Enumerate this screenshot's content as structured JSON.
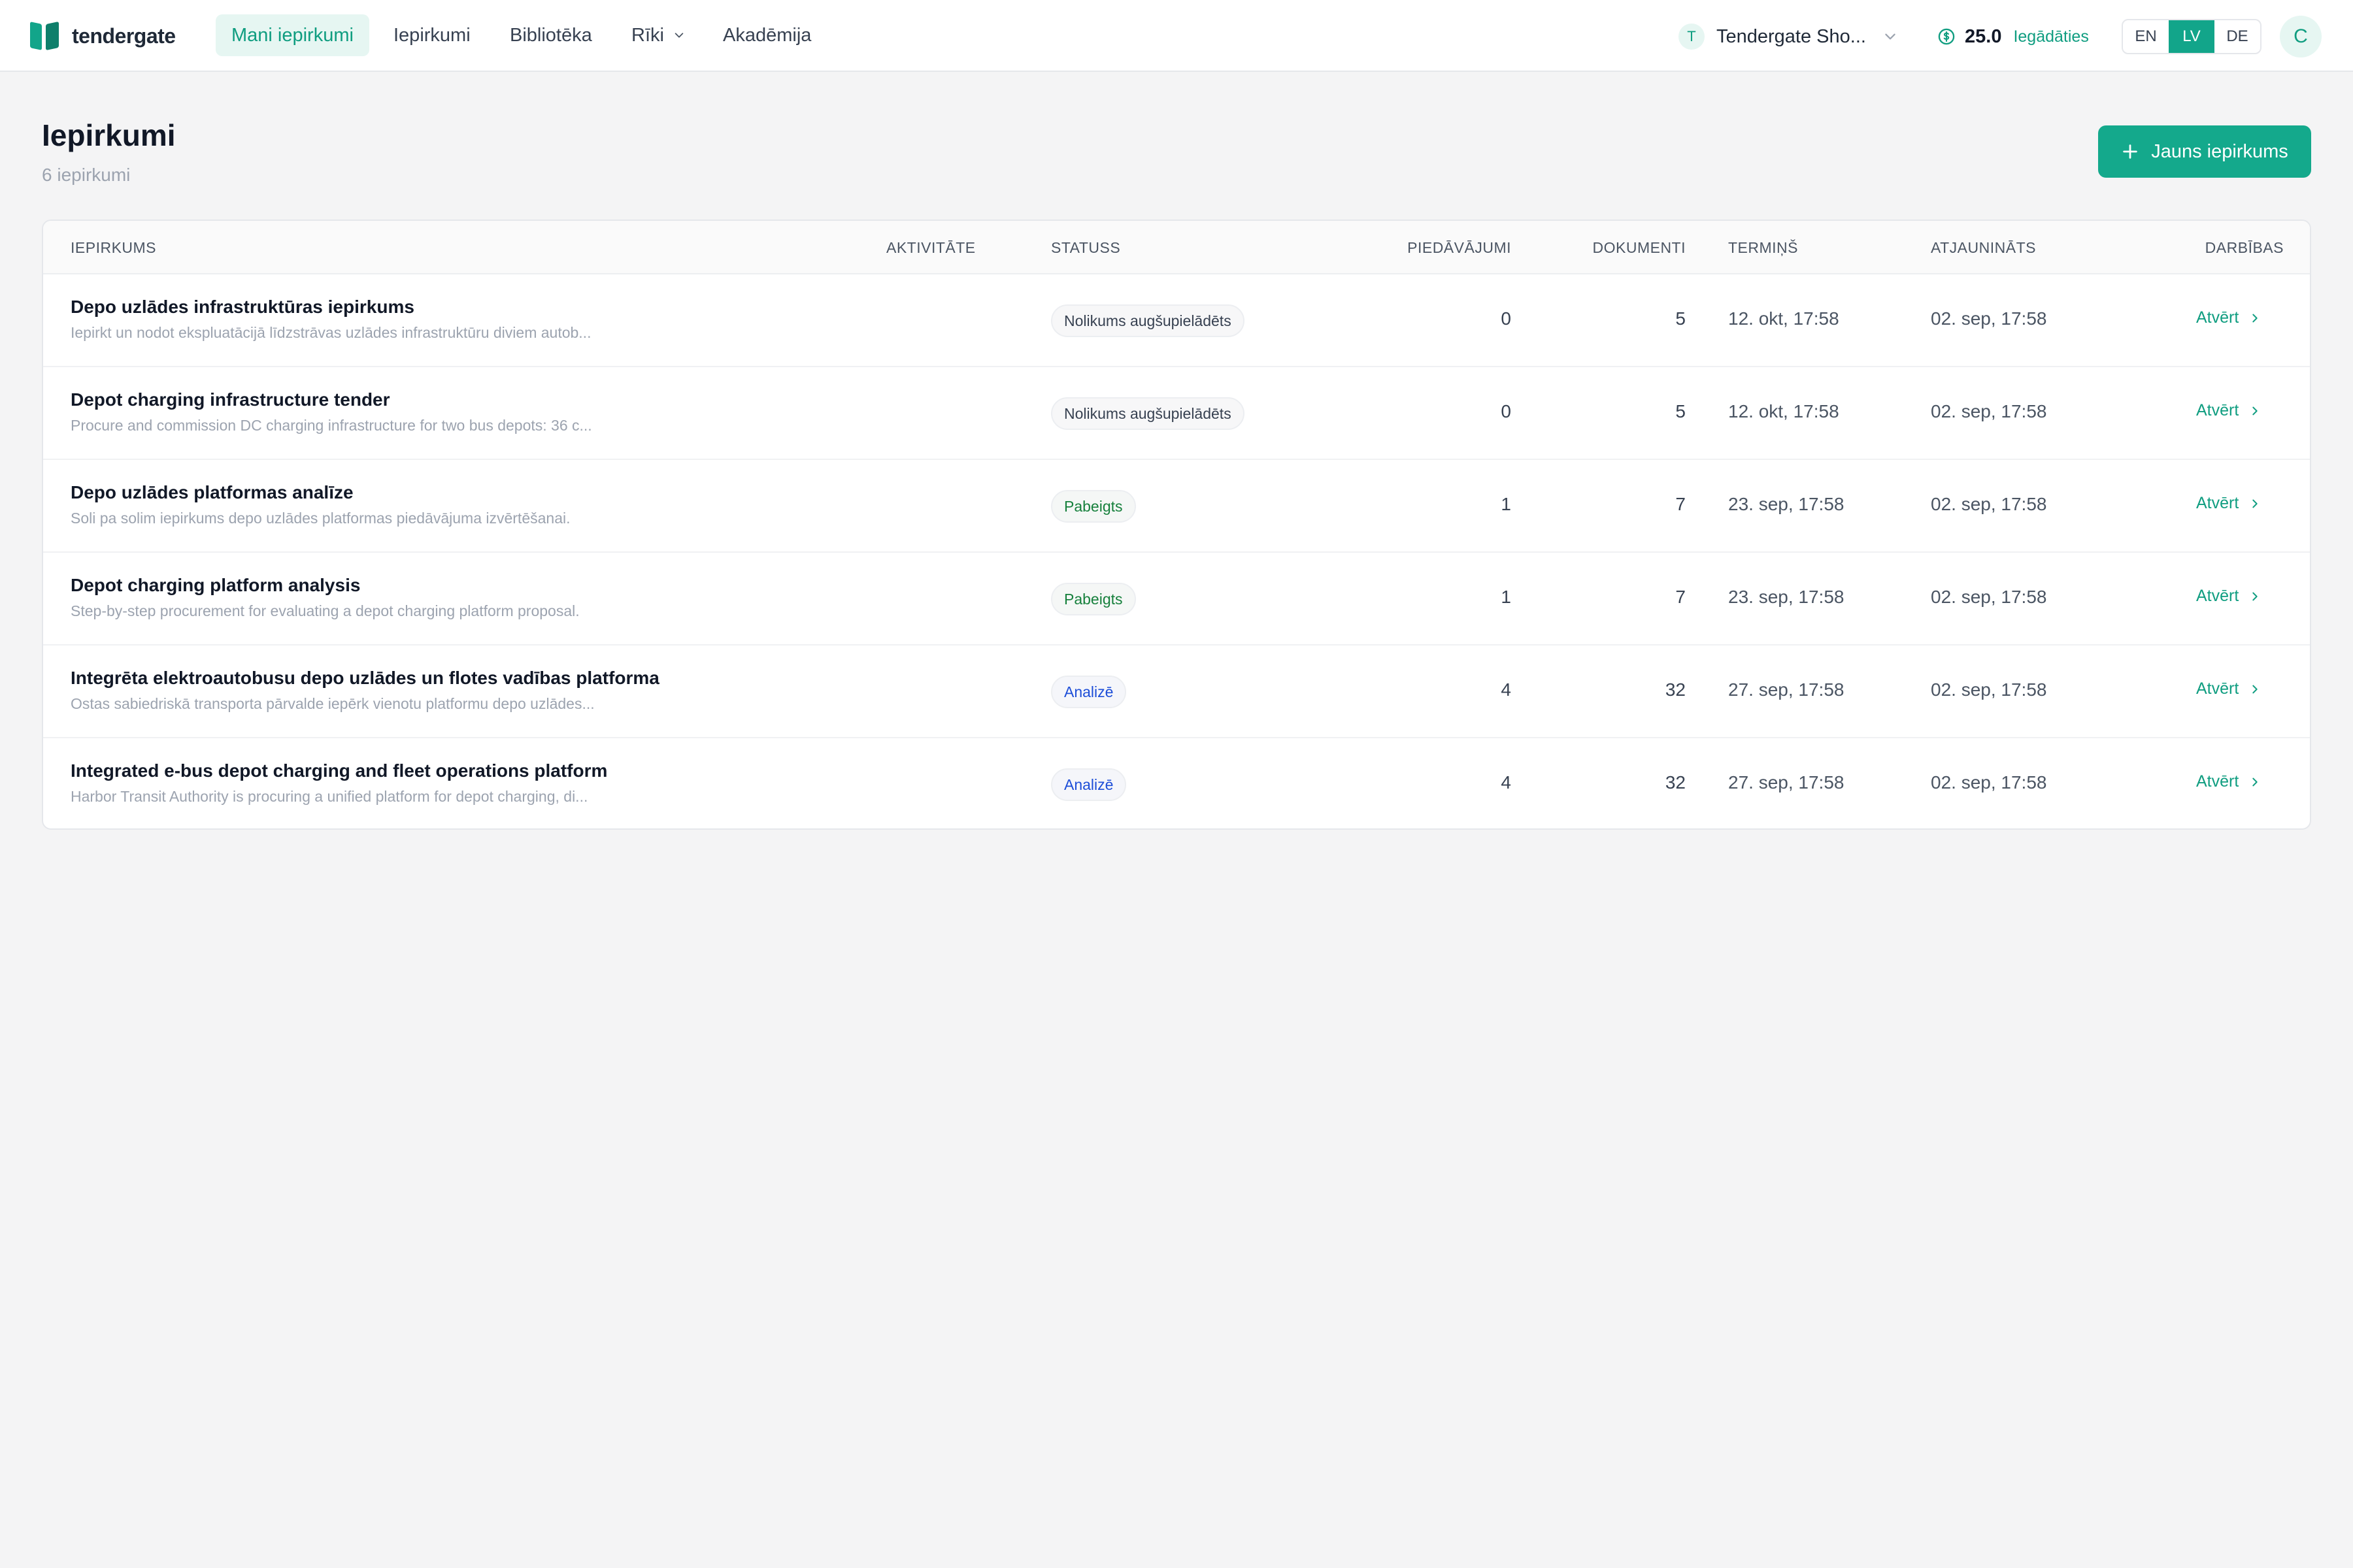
{
  "brand": {
    "name": "tendergate"
  },
  "nav": {
    "items": [
      {
        "label": "Mani iepirkumi",
        "active": true
      },
      {
        "label": "Iepirkumi",
        "active": false
      },
      {
        "label": "Bibliotēka",
        "active": false
      },
      {
        "label": "Rīki",
        "active": false,
        "has_dropdown": true
      },
      {
        "label": "Akadēmija",
        "active": false
      }
    ]
  },
  "team": {
    "initial": "T",
    "name": "Tendergate Sho..."
  },
  "credits": {
    "value": "25.0",
    "topup_label": "Iegādāties",
    "icon": "coin-icon"
  },
  "languages": {
    "options": [
      "EN",
      "LV",
      "DE"
    ],
    "selected": "LV"
  },
  "user": {
    "initial": "C"
  },
  "page": {
    "title": "Iepirkumi",
    "subtitle": "6 iepirkumi",
    "new_button_label": "Jauns iepirkums"
  },
  "table": {
    "headers": {
      "procurement": "IEPIRKUMS",
      "activity": "AKTIVITĀTE",
      "status": "STATUSS",
      "offers": "PIEDĀVĀJUMI",
      "documents": "DOKUMENTI",
      "deadline": "TERMIŅŠ",
      "updated": "ATJAUNINĀTS",
      "actions": "DARBĪBAS"
    },
    "rows": [
      {
        "title": "Depo uzlādes infrastruktūras iepirkums",
        "description": "Iepirkt un nodot ekspluatācijā līdzstrāvas uzlādes infrastruktūru diviem autob...",
        "status": "Nolikums augšupielādēts",
        "status_kind": "neutral",
        "offers": "0",
        "documents": "5",
        "deadline": "12. okt, 17:58",
        "updated": "02. sep, 17:58",
        "action": "Atvērt"
      },
      {
        "title": "Depot charging infrastructure tender",
        "description": "Procure and commission DC charging infrastructure for two bus depots: 36 c...",
        "status": "Nolikums augšupielādēts",
        "status_kind": "neutral",
        "offers": "0",
        "documents": "5",
        "deadline": "12. okt, 17:58",
        "updated": "02. sep, 17:58",
        "action": "Atvērt"
      },
      {
        "title": "Depo uzlādes platformas analīze",
        "description": "Soli pa solim iepirkums depo uzlādes platformas piedāvājuma izvērtēšanai.",
        "status": "Pabeigts",
        "status_kind": "green",
        "offers": "1",
        "documents": "7",
        "deadline": "23. sep, 17:58",
        "updated": "02. sep, 17:58",
        "action": "Atvērt"
      },
      {
        "title": "Depot charging platform analysis",
        "description": "Step-by-step procurement for evaluating a depot charging platform proposal.",
        "status": "Pabeigts",
        "status_kind": "green",
        "offers": "1",
        "documents": "7",
        "deadline": "23. sep, 17:58",
        "updated": "02. sep, 17:58",
        "action": "Atvērt"
      },
      {
        "title": "Integrēta elektroautobusu depo uzlādes un flotes vadības platforma",
        "description": "Ostas sabiedriskā transporta pārvalde iepērk vienotu platformu depo uzlādes...",
        "status": "Analizē",
        "status_kind": "blue",
        "offers": "4",
        "documents": "32",
        "deadline": "27. sep, 17:58",
        "updated": "02. sep, 17:58",
        "action": "Atvērt"
      },
      {
        "title": "Integrated e-bus depot charging and fleet operations platform",
        "description": "Harbor Transit Authority is procuring a unified platform for depot charging, di...",
        "status": "Analizē",
        "status_kind": "blue",
        "offers": "4",
        "documents": "32",
        "deadline": "27. sep, 17:58",
        "updated": "02. sep, 17:58",
        "action": "Atvērt"
      }
    ]
  },
  "colors": {
    "accent": "#14a98c",
    "accent_text": "#0f9d80",
    "status_green": "#16803c",
    "status_blue": "#1d4ed8"
  }
}
